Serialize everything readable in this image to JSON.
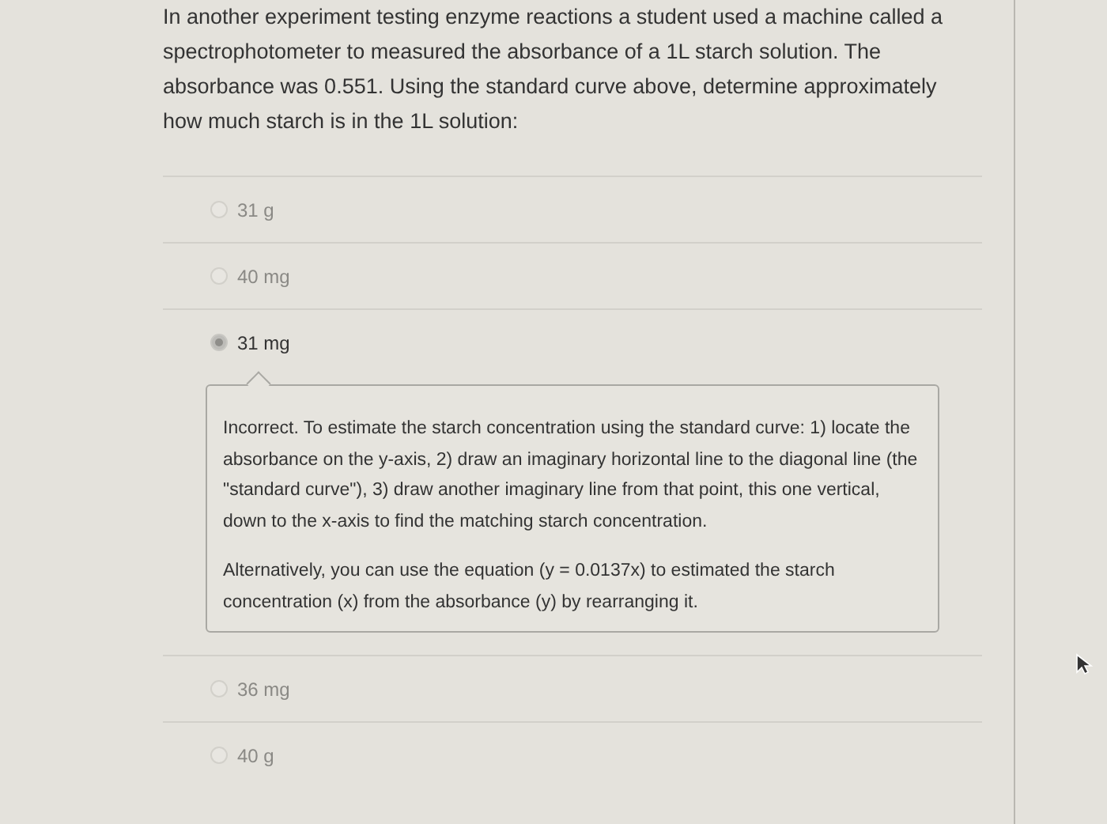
{
  "question": "In another experiment testing enzyme reactions a student used a machine called a spectrophotometer to measured the absorbance of a 1L starch solution. The absorbance was 0.551.  Using the standard curve above, determine approximately how much starch is in the 1L solution:",
  "options": [
    {
      "label": "31 g",
      "selected": false
    },
    {
      "label": "40 mg",
      "selected": false
    },
    {
      "label": "31 mg",
      "selected": true,
      "feedback": [
        "Incorrect.  To estimate the starch concentration using the standard curve: 1) locate the absorbance on the y-axis, 2) draw an imaginary horizontal line to the diagonal line (the \"standard curve\"), 3) draw another imaginary line from that point, this one vertical, down to the x-axis to find the matching starch concentration.",
        "Alternatively, you can use the equation (y = 0.0137x) to estimated the starch concentration (x) from the absorbance (y) by rearranging it."
      ]
    },
    {
      "label": "36 mg",
      "selected": false
    },
    {
      "label": "40 g",
      "selected": false
    }
  ]
}
